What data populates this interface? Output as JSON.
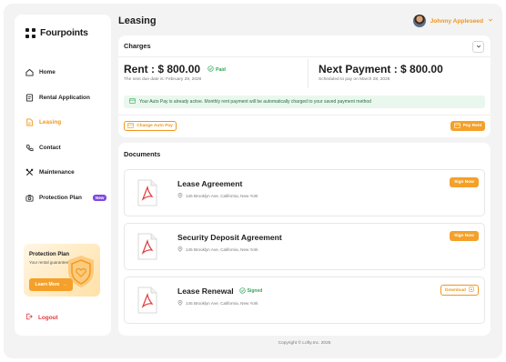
{
  "brand": {
    "name": "Fourpoints"
  },
  "sidebar": {
    "items": [
      {
        "label": "Home",
        "icon": "home-icon"
      },
      {
        "label": "Rental Application",
        "icon": "document-icon"
      },
      {
        "label": "Leasing",
        "icon": "file-icon",
        "active": true
      },
      {
        "label": "Contact",
        "icon": "phone-icon"
      },
      {
        "label": "Maintenance",
        "icon": "tools-icon"
      },
      {
        "label": "Protection Plan",
        "icon": "camera-icon",
        "badge": "New"
      }
    ],
    "promo": {
      "title": "Protection Plan",
      "subtitle": "Your rental guarantee",
      "button": "Learn More"
    },
    "logout": "Logout"
  },
  "header": {
    "title": "Leasing",
    "user": "Johnny Appleseed"
  },
  "charges": {
    "title": "Charges",
    "rent": "Rent : $ 800.00",
    "paid_label": "Paid",
    "due_text": "The next due date is: February 28, 2026",
    "next_payment": "Next Payment : $ 800.00",
    "scheduled_text": "Scheduled to pay on March 28, 2026",
    "autopay_notice": "Your Auto Pay is already active.  Monthly rent payment will be automatically charged to your saved payment method",
    "change_autopay": "Change Auto Pay",
    "pay_rent": "Pay Rent"
  },
  "documents": {
    "title": "Documents",
    "items": [
      {
        "title": "Lease Agreement",
        "address": "145 Brooklyn Ave, California, New York",
        "action": "Sign Now"
      },
      {
        "title": "Security Deposit Agreement",
        "address": "145 Brooklyn Ave, California, New York",
        "action": "Sign Now"
      },
      {
        "title": "Lease Renewal",
        "address": "145 Brooklyn Ave, California, New York",
        "status": "Signed",
        "action": "Download"
      }
    ]
  },
  "footer": {
    "copyright": "Copyright © Lofty.Inc. 2025"
  },
  "colors": {
    "accent": "#f4a02a",
    "success": "#2eaa55",
    "danger": "#e03a3a",
    "badge": "#7d4be0"
  }
}
